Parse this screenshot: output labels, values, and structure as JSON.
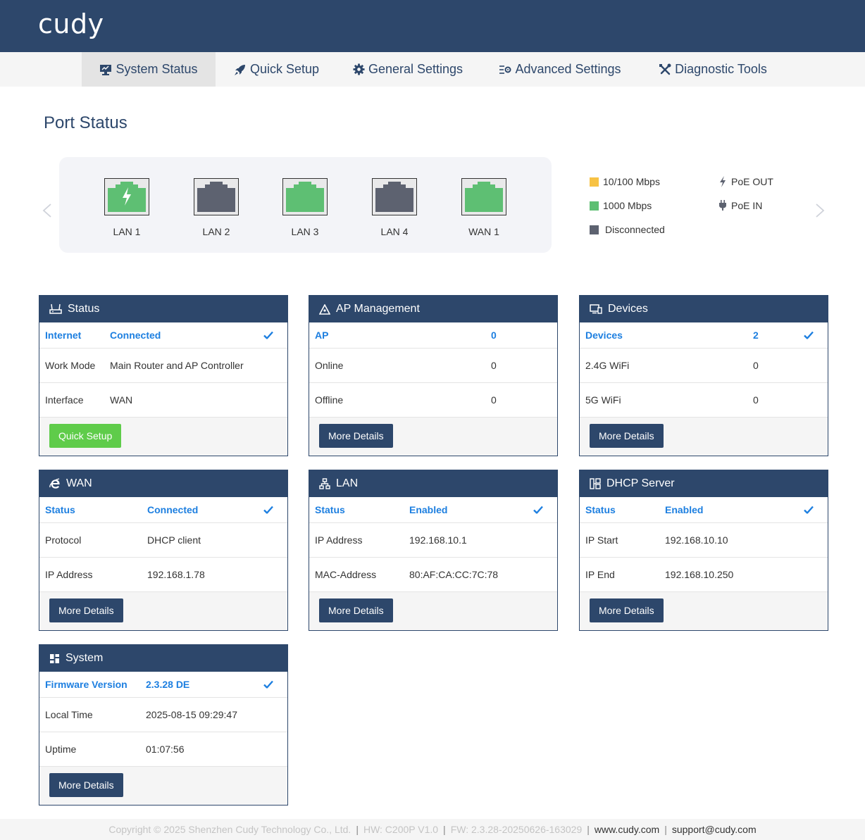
{
  "brand": {
    "logo_text": "cudy"
  },
  "nav": {
    "items": [
      {
        "label": "System Status",
        "active": true
      },
      {
        "label": "Quick Setup"
      },
      {
        "label": "General Settings"
      },
      {
        "label": "Advanced Settings"
      },
      {
        "label": "Diagnostic Tools"
      }
    ]
  },
  "port_status": {
    "title": "Port Status",
    "ports": [
      {
        "label": "LAN 1",
        "state": "1000 Mbps",
        "poe": "PoE OUT"
      },
      {
        "label": "LAN 2",
        "state": "Disconnected"
      },
      {
        "label": "LAN 3",
        "state": "1000 Mbps"
      },
      {
        "label": "LAN 4",
        "state": "Disconnected"
      },
      {
        "label": "WAN 1",
        "state": "1000 Mbps"
      }
    ],
    "legend": {
      "speed_100": "10/100 Mbps",
      "speed_1000": "1000 Mbps",
      "disconnected": "Disconnected",
      "poe_out": "PoE OUT",
      "poe_in": "PoE IN"
    },
    "colors": {
      "speed_100": "#f7c244",
      "speed_1000": "#5ebf73",
      "disconnected": "#5d6270"
    }
  },
  "cards": {
    "status": {
      "title": "Status",
      "rows": [
        {
          "key": "Internet",
          "value": "Connected"
        },
        {
          "key": "Work Mode",
          "value": "Main Router and AP Controller"
        },
        {
          "key": "Interface",
          "value": "WAN"
        }
      ],
      "button": "Quick Setup"
    },
    "ap": {
      "title": "AP Management",
      "rows": [
        {
          "key": "AP",
          "value": "0"
        },
        {
          "key": "Online",
          "value": "0"
        },
        {
          "key": "Offline",
          "value": "0"
        }
      ],
      "button": "More Details"
    },
    "devices": {
      "title": "Devices",
      "rows": [
        {
          "key": "Devices",
          "value": "2"
        },
        {
          "key": "2.4G WiFi",
          "value": "0"
        },
        {
          "key": "5G WiFi",
          "value": "0"
        }
      ],
      "button": "More Details"
    },
    "wan": {
      "title": "WAN",
      "rows": [
        {
          "key": "Status",
          "value": "Connected"
        },
        {
          "key": "Protocol",
          "value": "DHCP client"
        },
        {
          "key": "IP Address",
          "value": "192.168.1.78"
        }
      ],
      "button": "More Details"
    },
    "lan": {
      "title": "LAN",
      "rows": [
        {
          "key": "Status",
          "value": "Enabled"
        },
        {
          "key": "IP Address",
          "value": "192.168.10.1"
        },
        {
          "key": "MAC-Address",
          "value": "80:AF:CA:CC:7C:78"
        }
      ],
      "button": "More Details"
    },
    "dhcp": {
      "title": "DHCP Server",
      "rows": [
        {
          "key": "Status",
          "value": "Enabled"
        },
        {
          "key": "IP Start",
          "value": "192.168.10.10"
        },
        {
          "key": "IP End",
          "value": "192.168.10.250"
        }
      ],
      "button": "More Details"
    },
    "system": {
      "title": "System",
      "rows": [
        {
          "key": "Firmware Version",
          "value": "2.3.28 DE"
        },
        {
          "key": "Local Time",
          "value": "2025-08-15 09:29:47"
        },
        {
          "key": "Uptime",
          "value": "01:07:56"
        }
      ],
      "button": "More Details"
    }
  },
  "footer": {
    "copyright": "Copyright © 2025 Shenzhen Cudy Technology Co., Ltd.",
    "hw": "HW: C200P V1.0",
    "fw": "FW: 2.3.28-20250626-163029",
    "website": "www.cudy.com",
    "email": "support@cudy.com"
  },
  "theme": {
    "primary": "#2d476b",
    "accent_blue": "#1d7fe0",
    "green_button": "#5fcc4a"
  }
}
